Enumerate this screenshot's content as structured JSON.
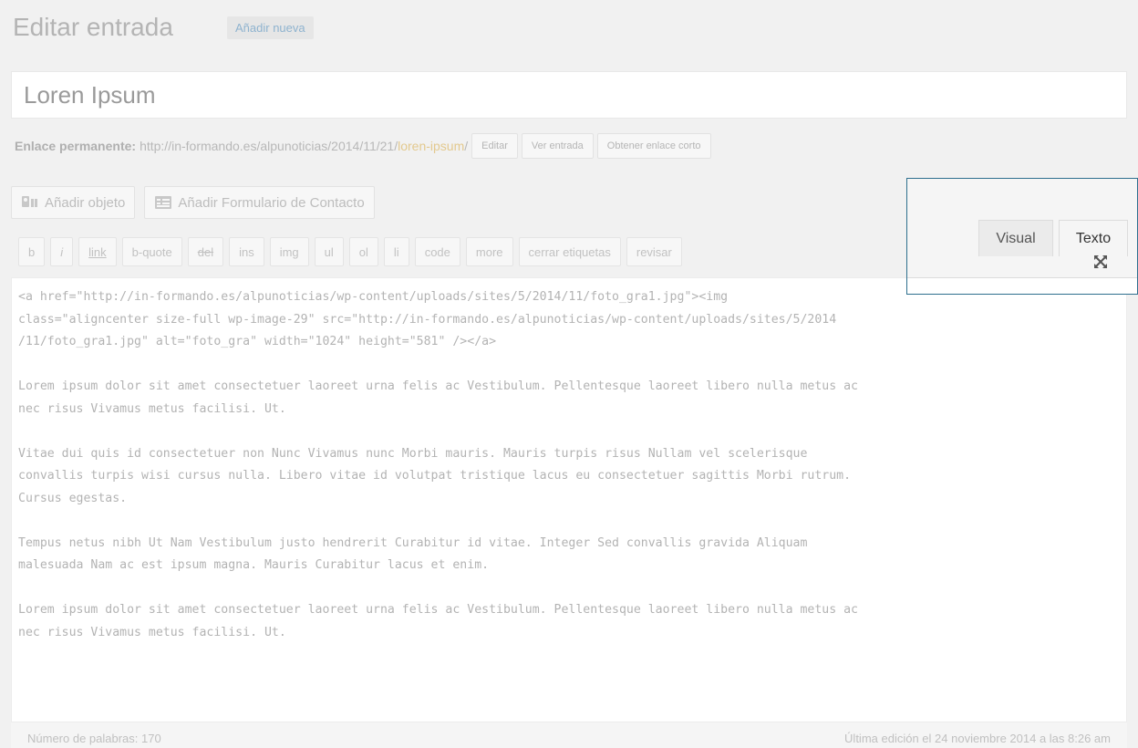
{
  "header": {
    "title": "Editar entrada",
    "add_new": "Añadir nueva"
  },
  "post": {
    "title": "Loren Ipsum"
  },
  "permalink": {
    "label": "Enlace permanente:",
    "base_url": "http://in-formando.es/alpunoticias/2014/11/21/",
    "slug": "loren-ipsum",
    "trailing": "/",
    "buttons": [
      "Editar",
      "Ver entrada",
      "Obtener enlace corto"
    ]
  },
  "media": {
    "add_object": "Añadir objeto",
    "add_contact_form": "Añadir Formulario de Contacto",
    "icons": [
      "media-icon",
      "form-icon"
    ]
  },
  "quicktags": [
    "b",
    "i",
    "link",
    "b-quote",
    "del",
    "ins",
    "img",
    "ul",
    "ol",
    "li",
    "code",
    "more",
    "cerrar etiquetas",
    "revisar"
  ],
  "editor_tabs": {
    "visual": "Visual",
    "text": "Texto",
    "active": "Texto"
  },
  "editor": {
    "content": "<a href=\"http://in-formando.es/alpunoticias/wp-content/uploads/sites/5/2014/11/foto_gra1.jpg\"><img\nclass=\"aligncenter size-full wp-image-29\" src=\"http://in-formando.es/alpunoticias/wp-content/uploads/sites/5/2014\n/11/foto_gra1.jpg\" alt=\"foto_gra\" width=\"1024\" height=\"581\" /></a>\n\nLorem ipsum dolor sit amet consectetuer laoreet urna felis ac Vestibulum. Pellentesque laoreet libero nulla metus ac\nnec risus Vivamus metus facilisi. Ut.\n\nVitae dui quis id consectetuer non Nunc Vivamus nunc Morbi mauris. Mauris turpis risus Nullam vel scelerisque\nconvallis turpis wisi cursus nulla. Libero vitae id volutpat tristique lacus eu consectetuer sagittis Morbi rutrum.\nCursus egestas.\n\nTempus netus nibh Ut Nam Vestibulum justo hendrerit Curabitur id vitae. Integer Sed convallis gravida Aliquam\nmalesuada Nam ac est ipsum magna. Mauris Curabitur lacus et enim.\n\nLorem ipsum dolor sit amet consectetuer laoreet urna felis ac Vestibulum. Pellentesque laoreet libero nulla metus ac\nnec risus Vivamus metus facilisi. Ut."
  },
  "status": {
    "word_count": "Número de palabras: 170",
    "last_edit": "Última edición el 24 noviembre 2014 a las 8:26 am"
  },
  "colors": {
    "callout_border": "#2e6f8e",
    "slug": "#e3c98e",
    "link_button": "#8fb3cf"
  }
}
